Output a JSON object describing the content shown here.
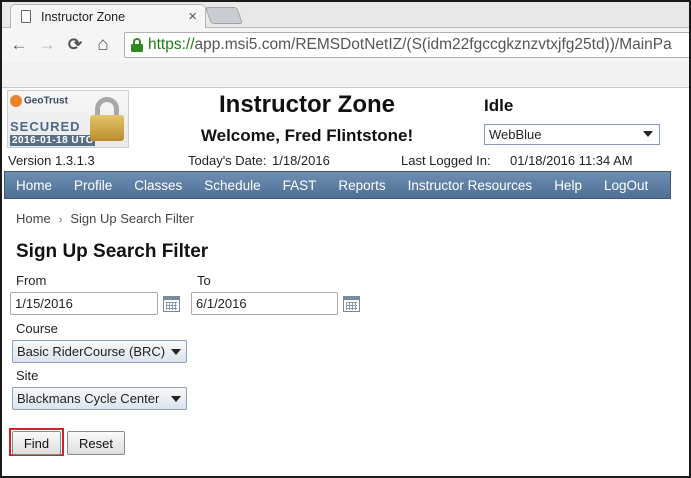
{
  "browser": {
    "tab_title": "Instructor Zone",
    "tab_close": "×",
    "url_scheme": "https://",
    "url_rest": "app.msi5.com/REMSDotNetIZ/(S(idm22fgccgkznzvtxjfg25td))/MainPa",
    "back_icon": "←",
    "forward_icon": "→",
    "reload_icon": "⟳",
    "home_icon": "⌂"
  },
  "seal": {
    "brand": "GeoTrust",
    "text": "SECURED",
    "date": "2016-01-18 UTC"
  },
  "header": {
    "title": "Instructor Zone",
    "welcome": "Welcome,  Fred Flintstone!",
    "status": "Idle",
    "theme_value": "WebBlue",
    "version": "Version 1.3.1.3",
    "today_label": "Today's Date:",
    "today_value": "1/18/2016",
    "last_logged_label": "Last Logged In:",
    "last_logged_value": "01/18/2016 11:34 AM"
  },
  "menu": {
    "items": [
      "Home",
      "Profile",
      "Classes",
      "Schedule",
      "FAST",
      "Reports",
      "Instructor Resources",
      "Help",
      "LogOut"
    ]
  },
  "breadcrumb": {
    "home": "Home",
    "separator": "›",
    "current": "Sign Up Search Filter"
  },
  "form": {
    "title": "Sign Up Search Filter",
    "from_label": "From",
    "from_value": "1/15/2016",
    "to_label": "To",
    "to_value": "6/1/2016",
    "course_label": "Course",
    "course_value": "Basic RiderCourse (BRC)",
    "site_label": "Site",
    "site_value": "Blackmans Cycle Center",
    "find_label": "Find",
    "reset_label": "Reset"
  },
  "colors": {
    "menu_bar": "#5b7ca2",
    "url_green": "#1e7d14",
    "highlight_red": "#d3202a"
  }
}
